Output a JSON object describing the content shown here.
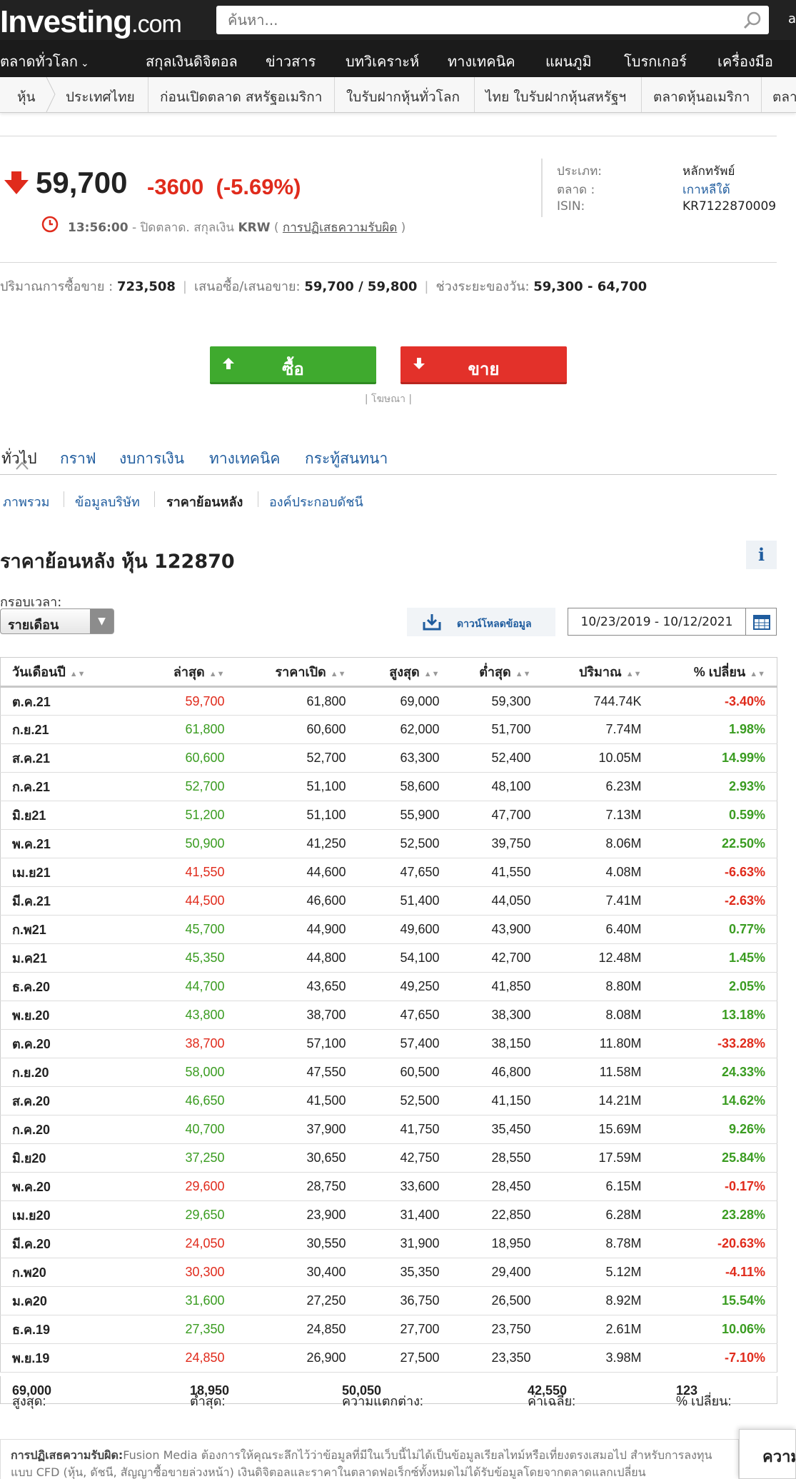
{
  "header": {
    "logo_main": "Investing",
    "logo_suffix": ".com",
    "search_placeholder": "ค้นหา...",
    "edge_text": "a"
  },
  "nav": {
    "items": [
      "ตลาดทั่วโลก",
      "สกุลเงินดิจิตอล",
      "ข่าวสาร",
      "บทวิเคราะห์",
      "ทางเทคนิค",
      "แผนภูมิ",
      "โบรกเกอร์",
      "เครื่องมือ"
    ]
  },
  "subnav": {
    "items": [
      "หุ้น",
      "ประเทศไทย",
      "ก่อนเปิดตลาด สหรัฐอเมริกา",
      "ใบรับฝากหุ้นทั่วโลก",
      "ไทย ใบรับฝากหุ้นสหรัฐฯ",
      "ตลาดหุ้นอเมริกา",
      "ตลา"
    ]
  },
  "quote": {
    "price": "59,700",
    "change": "-3600",
    "change_pct": "(-5.69%)",
    "time": "13:56:00",
    "status": " - ปิดตลาด. สกุลเงิน ",
    "currency": "KRW",
    "paren_open": " ( ",
    "disclaimer_link": "การปฏิเสธความรับผิด",
    "paren_close": " )",
    "info": {
      "type_label": "ประเภท:",
      "type_value": "หลักทรัพย์",
      "market_label": "ตลาด :",
      "market_value": "เกาหลีใต้",
      "isin_label": "ISIN:",
      "isin_value": "KR7122870009"
    },
    "stats": {
      "volume_label": "ปริมาณการซื้อขาย : ",
      "volume": "723,508",
      "bidask_label": "เสนอซื้อ/เสนอขาย: ",
      "bidask": "59,700 / 59,800",
      "range_label": "ช่วงระยะของวัน: ",
      "range": "59,300 - 64,700"
    }
  },
  "trade": {
    "buy_label": "ซื้อ",
    "sell_label": "ขาย",
    "ad_label": "| โฆษณา |",
    "buy_color": "#3faa2e",
    "sell_color": "#e3312a"
  },
  "tabs": [
    "ทั่วไป",
    "กราฟ",
    "งบการเงิน",
    "ทางเทคนิค",
    "กระทู้สนทนา"
  ],
  "subtabs": [
    "ภาพรวม",
    "ข้อมูลบริษัท",
    "ราคาย้อนหลัง",
    "องค์ประกอบดัชนี"
  ],
  "history": {
    "title": "ราคาย้อนหลัง หุ้น 122870",
    "info_icon": "i",
    "timeframe_label": "กรอบเวลา:",
    "timeframe_value": "รายเดือน",
    "download_label": "ดาวน์โหลดข้อมูล",
    "date_range": "10/23/2019 - 10/12/2021",
    "columns": [
      "วันเดือนปี",
      "ล่าสุด",
      "ราคาเปิด",
      "สูงสุด",
      "ต่ำสุด",
      "ปริมาณ",
      "% เปลี่ยน"
    ],
    "rows": [
      [
        "ต.ค.21",
        "59,700",
        "61,800",
        "69,000",
        "59,300",
        "744.74K",
        "-3.40%"
      ],
      [
        "ก.ย.21",
        "61,800",
        "60,600",
        "62,000",
        "51,700",
        "7.74M",
        "1.98%"
      ],
      [
        "ส.ค.21",
        "60,600",
        "52,700",
        "63,300",
        "52,400",
        "10.05M",
        "14.99%"
      ],
      [
        "ก.ค.21",
        "52,700",
        "51,100",
        "58,600",
        "48,100",
        "6.23M",
        "2.93%"
      ],
      [
        "มิ.ย21",
        "51,200",
        "51,100",
        "55,900",
        "47,700",
        "7.13M",
        "0.59%"
      ],
      [
        "พ.ค.21",
        "50,900",
        "41,250",
        "52,500",
        "39,750",
        "8.06M",
        "22.50%"
      ],
      [
        "เม.ย21",
        "41,550",
        "44,600",
        "47,650",
        "41,550",
        "4.08M",
        "-6.63%"
      ],
      [
        "มี.ค.21",
        "44,500",
        "46,600",
        "51,400",
        "44,050",
        "7.41M",
        "-2.63%"
      ],
      [
        "ก.พ21",
        "45,700",
        "44,900",
        "49,600",
        "43,900",
        "6.40M",
        "0.77%"
      ],
      [
        "ม.ค21",
        "45,350",
        "44,800",
        "54,100",
        "42,700",
        "12.48M",
        "1.45%"
      ],
      [
        "ธ.ค.20",
        "44,700",
        "43,650",
        "49,250",
        "41,850",
        "8.80M",
        "2.05%"
      ],
      [
        "พ.ย.20",
        "43,800",
        "38,700",
        "47,650",
        "38,300",
        "8.08M",
        "13.18%"
      ],
      [
        "ต.ค.20",
        "38,700",
        "57,100",
        "57,400",
        "38,150",
        "11.80M",
        "-33.28%"
      ],
      [
        "ก.ย.20",
        "58,000",
        "47,550",
        "60,500",
        "46,800",
        "11.58M",
        "24.33%"
      ],
      [
        "ส.ค.20",
        "46,650",
        "41,500",
        "52,500",
        "41,150",
        "14.21M",
        "14.62%"
      ],
      [
        "ก.ค.20",
        "40,700",
        "37,900",
        "41,750",
        "35,450",
        "15.69M",
        "9.26%"
      ],
      [
        "มิ.ย20",
        "37,250",
        "30,650",
        "42,750",
        "28,550",
        "17.59M",
        "25.84%"
      ],
      [
        "พ.ค.20",
        "29,600",
        "28,750",
        "33,600",
        "28,450",
        "6.15M",
        "-0.17%"
      ],
      [
        "เม.ย20",
        "29,650",
        "23,900",
        "31,400",
        "22,850",
        "6.28M",
        "23.28%"
      ],
      [
        "มี.ค.20",
        "24,050",
        "30,550",
        "31,900",
        "18,950",
        "8.78M",
        "-20.63%"
      ],
      [
        "ก.พ20",
        "30,300",
        "30,400",
        "35,350",
        "29,400",
        "5.12M",
        "-4.11%"
      ],
      [
        "ม.ค20",
        "31,600",
        "27,250",
        "36,750",
        "26,500",
        "8.92M",
        "15.54%"
      ],
      [
        "ธ.ค.19",
        "27,350",
        "24,850",
        "27,700",
        "23,750",
        "2.61M",
        "10.06%"
      ],
      [
        "พ.ย.19",
        "24,850",
        "26,900",
        "27,500",
        "23,350",
        "3.98M",
        "-7.10%"
      ]
    ],
    "summary": {
      "high_label": "สูงสุด: ",
      "high": "69,000",
      "low_label": "ต่ำสุด: ",
      "low": "18,950",
      "diff_label": "ความแตกต่าง: ",
      "diff": "50,050",
      "avg_label": "ค่าเฉลี่ย: ",
      "avg": "42,550",
      "pct_label": "% เปลี่ยน: ",
      "pct": "123"
    }
  },
  "footer": {
    "disclaimer_title": "การปฏิเสธความรับผิด:",
    "disclaimer_text": "Fusion Media ต้องการให้คุณระลึกไว้ว่าข้อมูลที่มีในเว็บนี้ไม่ได้เป็นข้อมูลเรียลไทม์หรือเที่ยงตรงเสมอไป สำหรับการลงทุนแบบ CFD (หุ้น, ดัชนี, สัญญาซื้อขายล่วงหน้า) เงินดิจิตอลและราคาในตลาดฟอเร็กซ์ทั้งหมดไม่ได้รับข้อมูลโดยจากตลาดแลกเปลี่ยน",
    "corner_tab": "ความ"
  },
  "colors": {
    "up": "#3a9c21",
    "down": "#e02b1c",
    "link": "#1f5c9e",
    "header_bg": "#222222"
  },
  "icons": {
    "search": "search-icon",
    "down_arrow": "red-down-arrow-icon",
    "clock": "clock-icon",
    "download": "download-icon",
    "calendar": "calendar-icon",
    "sort": "sort-icon",
    "chevron": "chevron-down-icon"
  }
}
